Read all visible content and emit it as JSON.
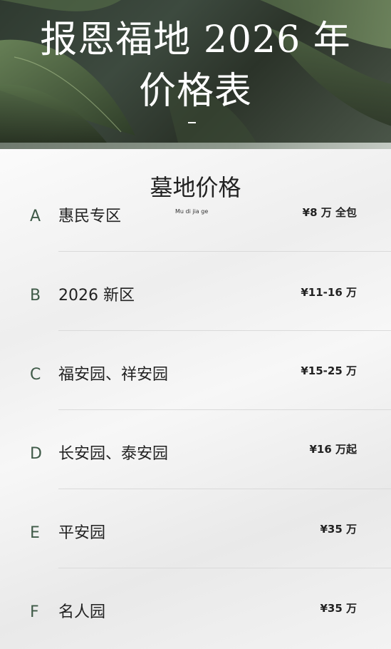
{
  "header": {
    "title_line_1": "报恩福地 2026 年",
    "title_line_2": "价格表",
    "dash": "–"
  },
  "section": {
    "title": "墓地价格",
    "subtitle": "Mu di jia ge"
  },
  "rows": [
    {
      "letter": "A",
      "name": "惠民专区",
      "price": "¥8 万 全包"
    },
    {
      "letter": "B",
      "name": "2026 新区",
      "price": "¥11-16 万"
    },
    {
      "letter": "C",
      "name": "福安园、祥安园",
      "price": "¥15-25 万"
    },
    {
      "letter": "D",
      "name": "长安园、泰安园",
      "price": "¥16 万起"
    },
    {
      "letter": "E",
      "name": "平安园",
      "price": "¥35 万"
    },
    {
      "letter": "F",
      "name": "名人园",
      "price": "¥35 万"
    }
  ],
  "colors": {
    "letter": "#3f5a48",
    "banner_dark": "#2f3a30",
    "leaf": "#5f7a52"
  },
  "decor": {
    "banner_image": "green-leaves-photo"
  }
}
